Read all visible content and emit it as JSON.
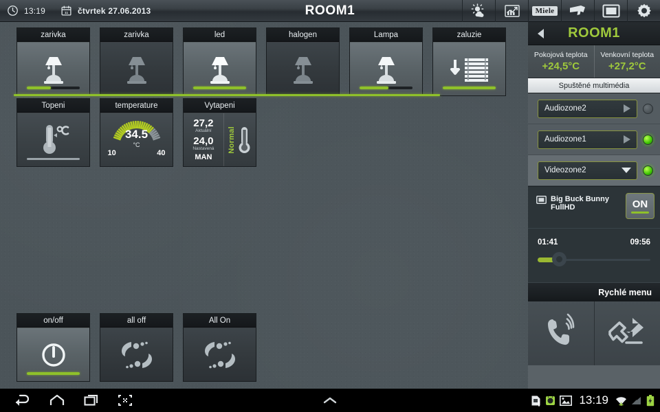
{
  "topbar": {
    "clock_icon": "clock-icon",
    "time": "13:19",
    "calendar_icon": "calendar-icon",
    "date": "čtvrtek  27.06.2013",
    "title": "ROOM1",
    "icons": [
      {
        "name": "weather-icon",
        "label": ""
      },
      {
        "name": "chart-icon",
        "label": ""
      },
      {
        "name": "miele-logo",
        "label": "Miele"
      },
      {
        "name": "camera-icon",
        "label": ""
      },
      {
        "name": "tv-icon",
        "label": ""
      },
      {
        "name": "settings-gear-icon",
        "label": ""
      }
    ]
  },
  "devices": {
    "row1": [
      {
        "label": "zarivka",
        "icon": "lamp-icon",
        "state": "on",
        "dimmer": 45,
        "show_dimmer": true
      },
      {
        "label": "zarivka",
        "icon": "lamp-icon",
        "state": "off",
        "dimmer": 0,
        "show_dimmer": false
      },
      {
        "label": "led",
        "icon": "lamp-icon",
        "state": "on",
        "dimmer": 100,
        "show_dimmer": true
      },
      {
        "label": "halogen",
        "icon": "lamp-icon",
        "state": "off",
        "dimmer": 0,
        "show_dimmer": false
      },
      {
        "label": "Lampa",
        "icon": "lamp-icon",
        "state": "on",
        "dimmer": 55,
        "show_dimmer": true
      },
      {
        "label": "zaluzie",
        "icon": "blinds-down-icon",
        "state": "on",
        "dimmer": 100,
        "show_dimmer": true
      }
    ],
    "row2": {
      "heating": {
        "label": "Topeni",
        "icon": "thermometer-celsius-icon"
      },
      "gauge": {
        "label": "temperature",
        "value": "34.5",
        "unit": "°C",
        "min": "10",
        "max": "40",
        "min_num": 10,
        "max_num": 40,
        "value_num": 34.5
      },
      "vytapeni": {
        "label": "Vytapeni",
        "actual_value": "27,2",
        "actual_label": "Aktuální",
        "set_value": "24,0",
        "set_label": "Nastavená",
        "mode": "MAN",
        "status": "Normal",
        "icon": "thermometer-icon"
      }
    },
    "scenes": [
      {
        "label": "on/off",
        "icon": "power-icon",
        "state": "on",
        "show_dimmer": true
      },
      {
        "label": "all off",
        "icon": "scene-icon",
        "state": "off",
        "show_dimmer": false
      },
      {
        "label": "All On",
        "icon": "scene-icon",
        "state": "off",
        "show_dimmer": false
      }
    ]
  },
  "panel": {
    "back_icon": "back-arrow-icon",
    "room": "ROOM1",
    "indoor": {
      "label": "Pokojová teplota",
      "value": "+24,5°C"
    },
    "outdoor": {
      "label": "Venkovní teplota",
      "value": "+27,2°C"
    },
    "section_title": "Spuštěné multimédia",
    "zones": [
      {
        "label": "Audiozone2",
        "arrow": "play-arrow-icon",
        "led": "off"
      },
      {
        "label": "Audiozone1",
        "arrow": "play-arrow-icon",
        "led": "on"
      },
      {
        "label": "Videozone2",
        "arrow": "chevron-down-icon",
        "led": "on"
      }
    ],
    "media": {
      "screen_icon": "video-screen-icon",
      "title": "Big Buck Bunny FullHD",
      "power_label": "ON",
      "elapsed": "01:41",
      "duration": "09:56",
      "progress": 17
    },
    "quick": {
      "title": "Rychlé menu",
      "items": [
        {
          "name": "intercom-call-icon"
        },
        {
          "name": "leave-house-icon"
        }
      ]
    }
  },
  "navbar": {
    "left": [
      {
        "name": "back-nav-icon"
      },
      {
        "name": "home-nav-icon"
      },
      {
        "name": "recents-nav-icon"
      },
      {
        "name": "screenshot-nav-icon"
      }
    ],
    "center": {
      "name": "keyboard-hide-icon"
    },
    "status": {
      "sim_icon": "sim-card-alert-icon",
      "adb_icon": "android-debug-icon",
      "image_icon": "image-icon",
      "time": "13:19",
      "wifi_icon": "wifi-icon",
      "signal_icon": "signal-icon",
      "battery_icon": "battery-charging-icon"
    }
  },
  "colors": {
    "accent_green": "#8fc12a",
    "panel_green": "#9fc93c",
    "tile_header": "#1a1e21",
    "wallpaper": "#4b5459"
  }
}
